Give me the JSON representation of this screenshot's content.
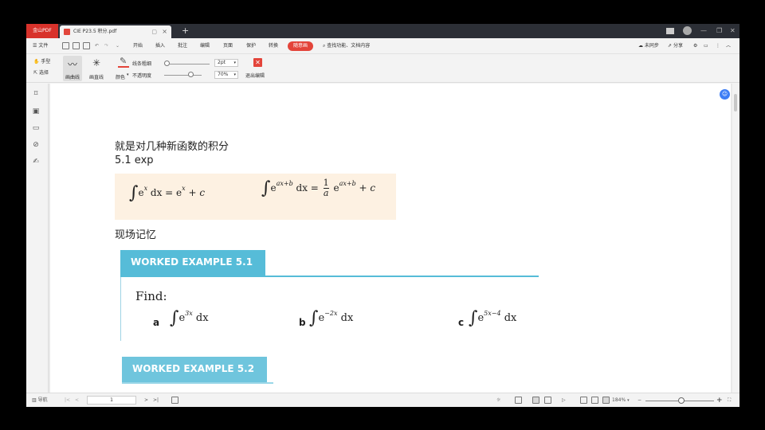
{
  "titlebar": {
    "brand": "金山PDF",
    "doc_tab": "CIE P23.5 积分.pdf",
    "new_tab": "+",
    "badge_num": "1"
  },
  "menu": {
    "file": "文件",
    "items": [
      "开始",
      "插入",
      "批注",
      "编辑",
      "页面",
      "保护",
      "转换"
    ],
    "highlight": "随意画",
    "search": "查找功能、文档内容",
    "sync": "未同步",
    "share": "分享"
  },
  "ribbon": {
    "hand": "手型",
    "select": "选择",
    "draw_curve": "画曲线",
    "draw_line": "画直线",
    "line_width_label": "线条粗细",
    "line_width_value": "2pt",
    "color_label": "颜色",
    "opacity_label": "不透明度",
    "opacity_value": "70%",
    "opacity_level": 0.7,
    "exit_edit": "退出编辑"
  },
  "document": {
    "para1": "就是对几种新函数的积分",
    "para2": "5.1 exp",
    "para3": "现场记忆",
    "formula1": {
      "base": "e",
      "exp": "x",
      "mid": "dx = e",
      "exp2": "x",
      "tail": "+ c"
    },
    "formula2": {
      "base": "e",
      "exp": "ax+b",
      "mid": "dx =",
      "num": "1",
      "den": "a",
      "base2": "e",
      "exp2": "ax+b",
      "tail": "+ c"
    },
    "we1": {
      "title": "WORKED EXAMPLE 5.1",
      "find": "Find:",
      "parts": [
        {
          "label": "a",
          "exp": "3x"
        },
        {
          "label": "b",
          "exp": "−2x"
        },
        {
          "label": "c",
          "exp": "5x−4"
        }
      ],
      "base": "e",
      "dx": "dx"
    },
    "we2": {
      "title": "WORKED EXAMPLE 5.2"
    }
  },
  "statusbar": {
    "nav": "导航",
    "page": "1",
    "zoom": "184%",
    "zoom_plus": "+"
  },
  "colors": {
    "brand_red": "#d8322b",
    "accent_red": "#e3443a",
    "worked_blue": "#56bcd8",
    "formula_bg": "#fdf1e2",
    "float_blue": "#3d7ef5"
  }
}
